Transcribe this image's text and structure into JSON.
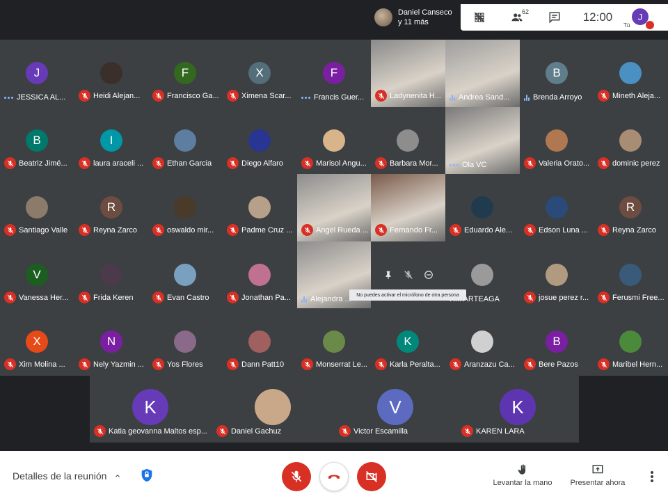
{
  "presenter": {
    "line1": "Daniel Canseco",
    "line2": "y 11 más"
  },
  "topbar": {
    "participants_count": "62",
    "clock": "12:00",
    "me_initial": "J",
    "me_label": "Tú"
  },
  "colors": {
    "mic_off": "#d93025",
    "accent_purple": "#673ab7",
    "speaking": "#8ab4f8"
  },
  "participants": [
    {
      "name": "JESSICA AL...",
      "initial": "J",
      "color": "#673ab7",
      "status": "dots"
    },
    {
      "name": "Heidi Alejan...",
      "initial": "",
      "color": "#3a2f2a",
      "status": "muted"
    },
    {
      "name": "Francisco Ga...",
      "initial": "F",
      "color": "#33691e",
      "status": "muted"
    },
    {
      "name": "Ximena Scar...",
      "initial": "X",
      "color": "#546e7a",
      "status": "muted"
    },
    {
      "name": "Francis Guer...",
      "initial": "F",
      "color": "#7b1fa2",
      "status": "dots"
    },
    {
      "name": "Ladynenita H...",
      "initial": "",
      "color": "#8a8a8a",
      "status": "muted",
      "video": true
    },
    {
      "name": "Andrea Sand...",
      "initial": "",
      "color": "#9e9e9e",
      "status": "speaking",
      "video": true
    },
    {
      "name": "Brenda Arroyo",
      "initial": "B",
      "color": "#607d8b",
      "status": "speaking"
    },
    {
      "name": "Mineth Aleja...",
      "initial": "",
      "color": "#4a90c2",
      "status": "muted"
    },
    {
      "name": "Beatriz Jimé...",
      "initial": "B",
      "color": "#00796b",
      "status": "muted"
    },
    {
      "name": "laura araceli ...",
      "initial": "I",
      "color": "#0097a7",
      "status": "muted"
    },
    {
      "name": "Ethan Garcia",
      "initial": "",
      "color": "#5d7ea0",
      "status": "muted"
    },
    {
      "name": "Diego Alfaro",
      "initial": "",
      "color": "#283593",
      "status": "muted"
    },
    {
      "name": "Marisol Angu...",
      "initial": "",
      "color": "#d7b48a",
      "status": "muted"
    },
    {
      "name": "Barbara Mor...",
      "initial": "",
      "color": "#8d8d8d",
      "status": "muted"
    },
    {
      "name": "Ola VC",
      "initial": "",
      "color": "#7a7a7a",
      "status": "dots",
      "video": true
    },
    {
      "name": "Valeria Orato...",
      "initial": "",
      "color": "#b07850",
      "status": "muted"
    },
    {
      "name": "dominic perez",
      "initial": "",
      "color": "#a98c74",
      "status": "muted"
    },
    {
      "name": "Santiago Valle",
      "initial": "",
      "color": "#8c7a6a",
      "status": "muted"
    },
    {
      "name": "Reyna Zarco",
      "initial": "R",
      "color": "#6d4c41",
      "status": "muted"
    },
    {
      "name": "oswaldo mir...",
      "initial": "",
      "color": "#4a3a2a",
      "status": "muted"
    },
    {
      "name": "Padme Cruz ...",
      "initial": "",
      "color": "#b7a08a",
      "status": "muted"
    },
    {
      "name": "Angel Rueda ...",
      "initial": "",
      "color": "#8d8d8d",
      "status": "muted",
      "video": true
    },
    {
      "name": "Fernando Fr...",
      "initial": "",
      "color": "#7a5a4a",
      "status": "muted",
      "video": true
    },
    {
      "name": "Eduardo Ale...",
      "initial": "",
      "color": "#1f3b4d",
      "status": "muted"
    },
    {
      "name": "Edson Luna ...",
      "initial": "",
      "color": "#2a4a7a",
      "status": "muted"
    },
    {
      "name": "Reyna Zarco",
      "initial": "R",
      "color": "#6d4c41",
      "status": "muted"
    },
    {
      "name": "Vanessa Her...",
      "initial": "V",
      "color": "#1b5e20",
      "status": "muted"
    },
    {
      "name": "Frida Keren",
      "initial": "",
      "color": "#4a3a4a",
      "status": "muted"
    },
    {
      "name": "Evan Castro",
      "initial": "",
      "color": "#7aa0c0",
      "status": "muted"
    },
    {
      "name": "Jonathan Pa...",
      "initial": "",
      "color": "#c07090",
      "status": "muted"
    },
    {
      "name": "Alejandra ...",
      "initial": "",
      "color": "#8d8d8d",
      "status": "speaking",
      "video": true
    },
    {
      "name": "",
      "initial": "",
      "color": "#3c4043",
      "status": "none"
    },
    {
      "name": "RM ARTEAGA",
      "initial": "",
      "color": "#9a9a9a",
      "status": "none"
    },
    {
      "name": "josue perez r...",
      "initial": "",
      "color": "#b09a80",
      "status": "muted"
    },
    {
      "name": "Ferusmi Free...",
      "initial": "",
      "color": "#3a5a7a",
      "status": "muted"
    },
    {
      "name": "Xim Molina ...",
      "initial": "X",
      "color": "#e64a19",
      "status": "muted"
    },
    {
      "name": "Nely Yazmin ...",
      "initial": "N",
      "color": "#7b1fa2",
      "status": "muted"
    },
    {
      "name": "Yos Flores",
      "initial": "",
      "color": "#8a6a8a",
      "status": "muted"
    },
    {
      "name": "Dann Patt10",
      "initial": "",
      "color": "#a06060",
      "status": "muted"
    },
    {
      "name": "Monserrat Le...",
      "initial": "",
      "color": "#6a8a4a",
      "status": "muted"
    },
    {
      "name": "Karla Peralta...",
      "initial": "K",
      "color": "#00897b",
      "status": "muted"
    },
    {
      "name": "Aranzazu Ca...",
      "initial": "",
      "color": "#d0d0d0",
      "status": "muted"
    },
    {
      "name": "Bere Pazos",
      "initial": "B",
      "color": "#7b1fa2",
      "status": "muted"
    },
    {
      "name": "Maribel Hern...",
      "initial": "",
      "color": "#4a8a3a",
      "status": "muted"
    }
  ],
  "hover": {
    "tooltip": "No puedes activar el micrófono de otra persona"
  },
  "bottom_tiles": [
    {
      "name": "Katia geovanna Maltos esp...",
      "initial": "K",
      "color": "#673ab7"
    },
    {
      "name": "Daniel Gachuz",
      "initial": "",
      "color": "#c9a88a"
    },
    {
      "name": "Victor Escamilla",
      "initial": "V",
      "color": "#5c6bc0"
    },
    {
      "name": "KAREN LARA",
      "initial": "K",
      "color": "#5e35b1"
    }
  ],
  "controls": {
    "details": "Detalles de la reunión",
    "raise_hand": "Levantar la mano",
    "present": "Presentar ahora"
  }
}
